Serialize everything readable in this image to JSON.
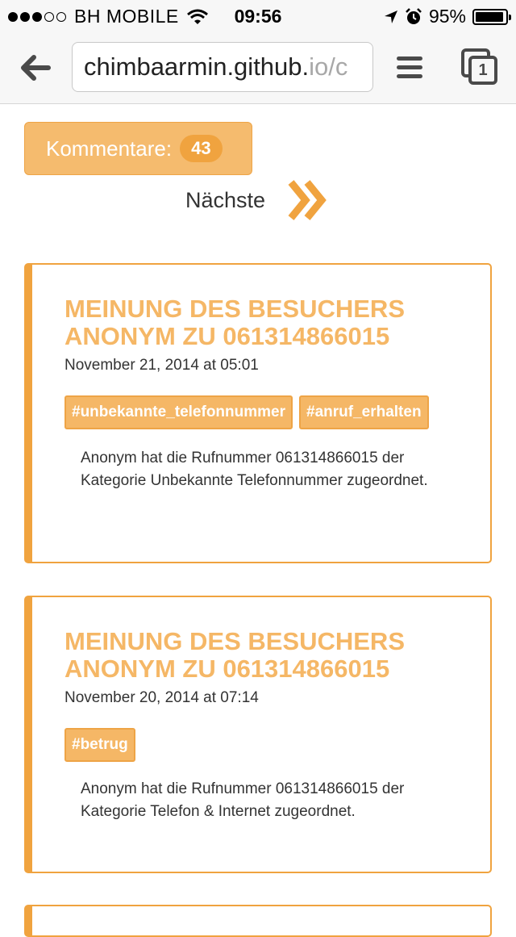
{
  "status_bar": {
    "carrier": "BH MOBILE",
    "time": "09:56",
    "battery_percent_label": "95%",
    "battery_level": 0.95,
    "signal_bars_filled": 3,
    "signal_bars_total": 5
  },
  "browser": {
    "url_host": "chimbaarmin.github.",
    "url_path": "io/c",
    "tab_count": "1"
  },
  "page": {
    "comments_label": "Kommentare:",
    "comments_count": "43",
    "next_label": "Nächste",
    "accent_color": "#f0a33f"
  },
  "cards": [
    {
      "title": "MEINUNG DES BESUCHERS ANONYM ZU 061314866015",
      "date": "November 21, 2014 at 05:01",
      "tags": [
        "#unbekannte_telefonnummer",
        "#anruf_erhalten"
      ],
      "text": "Anonym hat die Rufnummer 061314866015 der Kategorie Unbekannte Telefonnummer zugeordnet."
    },
    {
      "title": "MEINUNG DES BESUCHERS ANONYM ZU 061314866015",
      "date": "November 20, 2014 at 07:14",
      "tags": [
        "#betrug"
      ],
      "text": "Anonym hat die Rufnummer 061314866015 der Kategorie Telefon & Internet zugeordnet."
    }
  ]
}
